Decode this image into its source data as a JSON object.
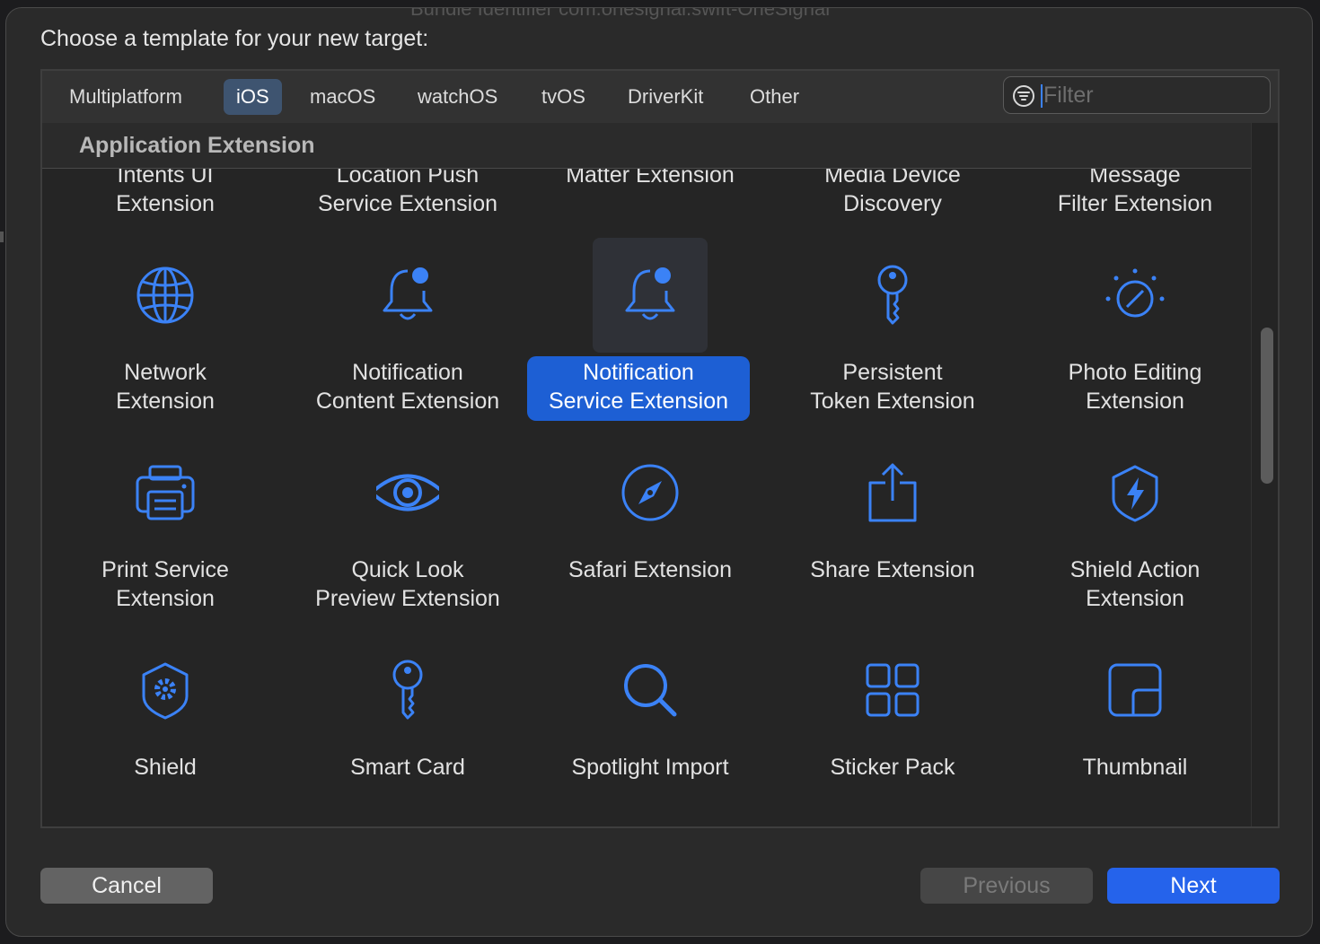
{
  "background_title": "Bundle Identifier   com.onesignal.swift-OneSignal",
  "dialog": {
    "heading": "Choose a template for your new target:"
  },
  "tabs": [
    {
      "label": "Multiplatform",
      "selected": false
    },
    {
      "label": "iOS",
      "selected": true
    },
    {
      "label": "macOS",
      "selected": false
    },
    {
      "label": "watchOS",
      "selected": false
    },
    {
      "label": "tvOS",
      "selected": false
    },
    {
      "label": "DriverKit",
      "selected": false
    },
    {
      "label": "Other",
      "selected": false
    }
  ],
  "filter": {
    "placeholder": "Filter",
    "value": ""
  },
  "section": {
    "title": "Application Extension"
  },
  "templates": [
    {
      "line1": "Intents UI",
      "line2": "Extension",
      "icon": "intents-ui-icon"
    },
    {
      "line1": "Location Push",
      "line2": "Service Extension",
      "icon": "location-push-icon"
    },
    {
      "line1": "Matter Extension",
      "line2": "",
      "icon": "matter-icon"
    },
    {
      "line1": "Media Device",
      "line2": "Discovery",
      "icon": "media-device-icon"
    },
    {
      "line1": "Message",
      "line2": "Filter Extension",
      "icon": "message-filter-icon"
    },
    {
      "line1": "Network",
      "line2": "Extension",
      "icon": "globe-icon"
    },
    {
      "line1": "Notification",
      "line2": "Content Extension",
      "icon": "bell-badge-icon"
    },
    {
      "line1": "Notification",
      "line2": "Service Extension",
      "icon": "bell-badge-icon",
      "selected": true
    },
    {
      "line1": "Persistent",
      "line2": "Token Extension",
      "icon": "key-icon"
    },
    {
      "line1": "Photo Editing",
      "line2": "Extension",
      "icon": "photo-dial-icon"
    },
    {
      "line1": "Print Service",
      "line2": "Extension",
      "icon": "printer-icon"
    },
    {
      "line1": "Quick Look",
      "line2": "Preview Extension",
      "icon": "eye-icon"
    },
    {
      "line1": "Safari Extension",
      "line2": "",
      "icon": "compass-icon"
    },
    {
      "line1": "Share Extension",
      "line2": "",
      "icon": "share-icon"
    },
    {
      "line1": "Shield Action",
      "line2": "Extension",
      "icon": "shield-bolt-icon"
    },
    {
      "line1": "Shield",
      "line2": "",
      "icon": "shield-gear-icon"
    },
    {
      "line1": "Smart Card",
      "line2": "",
      "icon": "key-icon"
    },
    {
      "line1": "Spotlight Import",
      "line2": "",
      "icon": "magnifier-icon"
    },
    {
      "line1": "Sticker Pack",
      "line2": "",
      "icon": "grid-icon"
    },
    {
      "line1": "Thumbnail",
      "line2": "",
      "icon": "thumbnail-icon"
    }
  ],
  "buttons": {
    "cancel": "Cancel",
    "previous": "Previous",
    "next": "Next"
  },
  "colors": {
    "accent": "#2563eb",
    "icon_blue": "#3b82f6",
    "selection": "#1d5fd4"
  }
}
